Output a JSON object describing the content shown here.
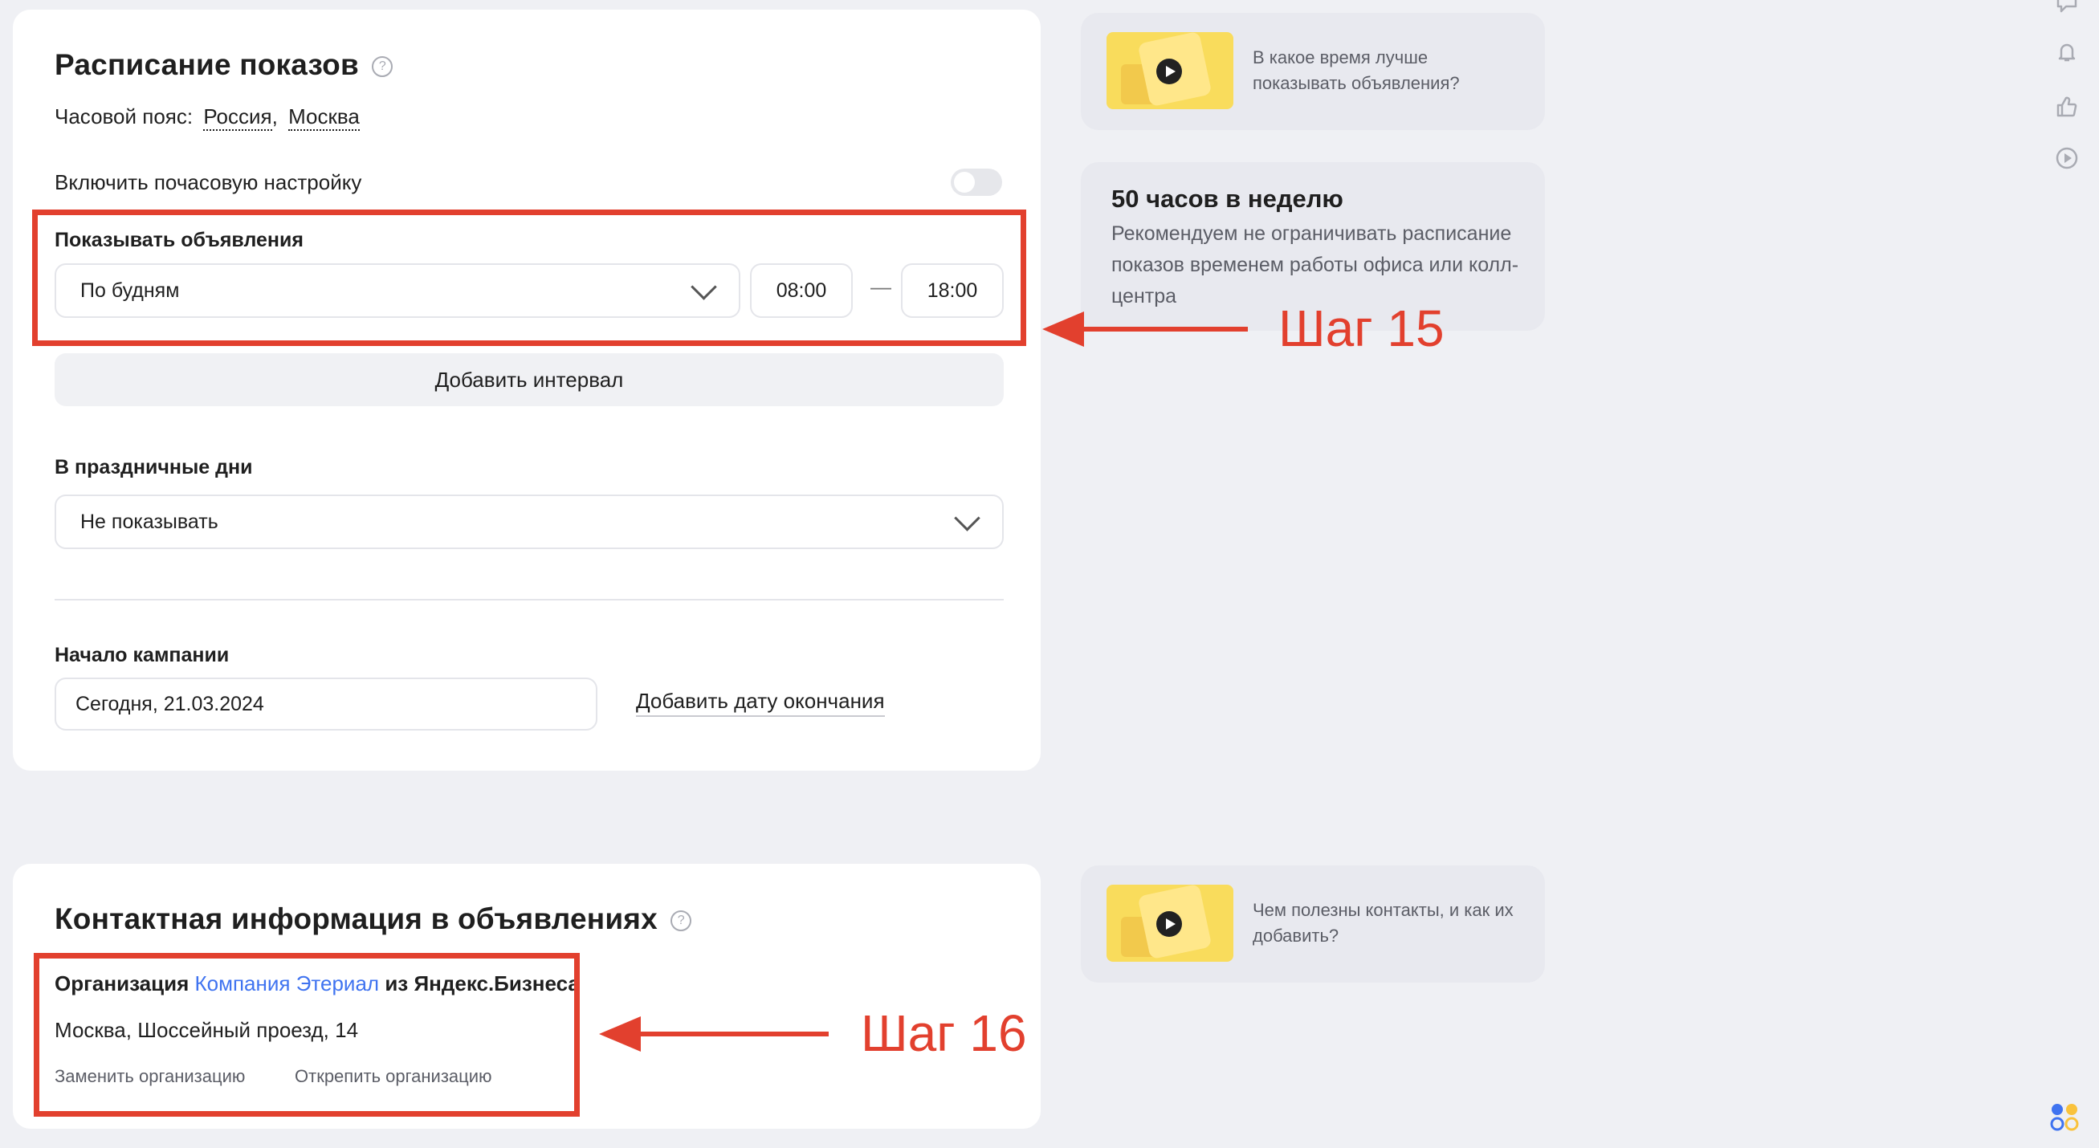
{
  "schedule": {
    "title": "Расписание показов",
    "timezone_label": "Часовой пояс:",
    "timezone_country": "Россия",
    "timezone_sep": ",",
    "timezone_city": "Москва",
    "hourly_toggle_label": "Включить почасовую настройку",
    "show_ads_label": "Показывать объявления",
    "days_value": "По будням",
    "time_from": "08:00",
    "time_dash": "—",
    "time_to": "18:00",
    "add_interval": "Добавить интервал",
    "holidays_label": "В праздничные дни",
    "holidays_value": "Не показывать",
    "campaign_start_label": "Начало кампании",
    "campaign_start_value": "Сегодня, 21.03.2024",
    "add_end_date": "Добавить дату окончания"
  },
  "contacts": {
    "title": "Контактная информация в объявлениях",
    "org_prefix": "Организация",
    "org_name": "Компания Этериал",
    "org_suffix": "из Яндекс.Бизнеса",
    "address": "Москва, Шоссейный проезд, 14",
    "replace_org": "Заменить организацию",
    "detach_org": "Открепить организацию"
  },
  "side": {
    "video1_text": "В какое время лучше показывать объявления?",
    "tip_title": "50 часов в неделю",
    "tip_text": "Рекомендуем не ограничивать расписание показов временем работы офиса или колл-центра",
    "video2_text": "Чем полезны контакты, и как их добавить?"
  },
  "annotations": {
    "step15": "Шаг 15",
    "step16": "Шаг 16"
  },
  "colors": {
    "accent_link": "#3f73f0",
    "annotation_red": "#e2402e",
    "page_bg": "#eff0f4"
  },
  "icons": [
    "help-icon",
    "chevron-down-icon",
    "play-icon",
    "chat-icon",
    "bell-icon",
    "thumbs-up-icon",
    "play-circle-icon",
    "toggle-switch"
  ]
}
